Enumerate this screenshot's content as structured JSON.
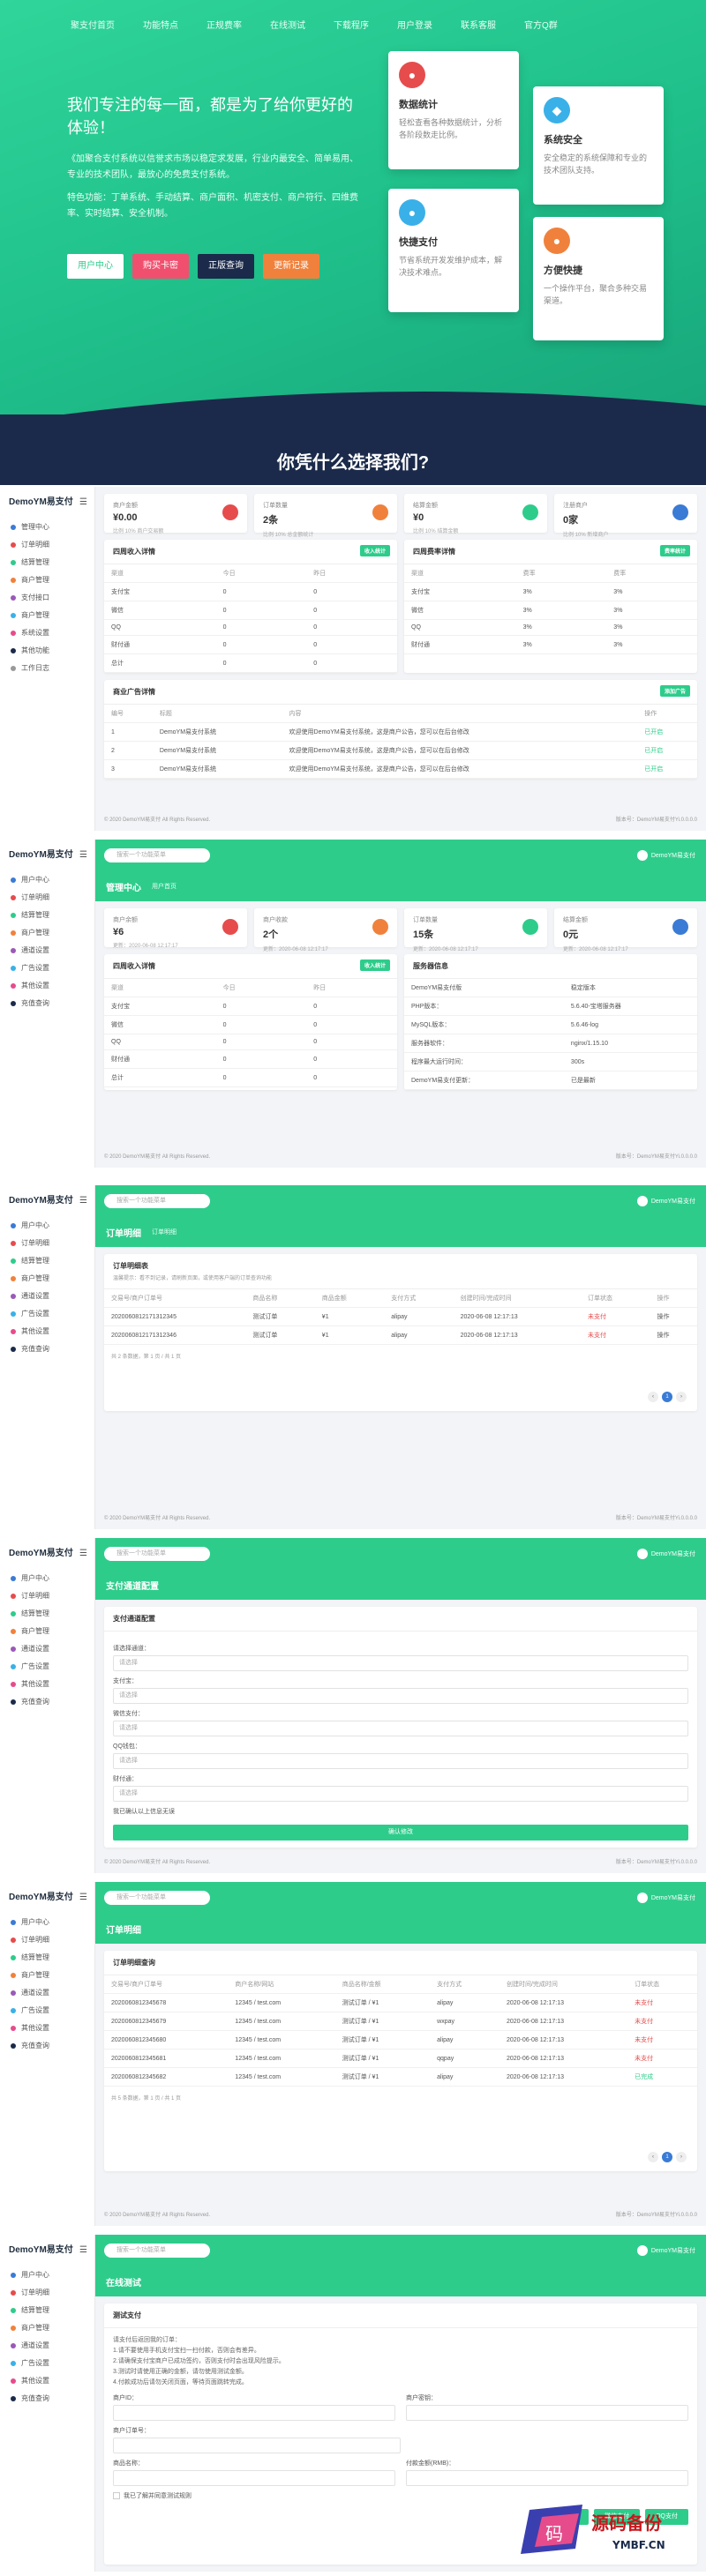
{
  "nav": [
    "聚支付首页",
    "功能特点",
    "正规费率",
    "在线测试",
    "下载程序",
    "用户登录",
    "联系客服",
    "官方Q群"
  ],
  "hero": {
    "title": "我们专注的每一面，都是为了给你更好的体验！",
    "desc1": "《加聚合支付系统以信誉求市场以稳定求发展，行业内最安全、简单易用、专业的技术团队，最放心的免费支付系统。",
    "desc2": "特色功能：丁单系统、手动结算、商户面积、机密支付、商户符行、四维费率、实时结算、安全机制。",
    "buttons": [
      "用户中心",
      "购买卡密",
      "正版查询",
      "更新记录"
    ]
  },
  "features": [
    {
      "icon": "data-stats-icon",
      "title": "数据统计",
      "desc": "轻松查看各种数据统计，分析各阶段数走比例。",
      "color": "#e64c4c"
    },
    {
      "icon": "security-icon",
      "title": "系统安全",
      "desc": "安全稳定的系统保障和专业的技术团队支持。",
      "color": "#3ab0e8"
    },
    {
      "icon": "fast-pay-icon",
      "title": "快捷支付",
      "desc": "节省系统开发发维护成本，解决技术难点。",
      "color": "#3ab0e8"
    },
    {
      "icon": "convenient-icon",
      "title": "方便快捷",
      "desc": "一个操作平台，聚合多种交易渠道。",
      "color": "#f0813c"
    }
  ],
  "why_title": "你凭什么选择我们?",
  "admin": {
    "brand": "DemoYM易支付",
    "menu": [
      "管理中心",
      "订单明细",
      "结算管理",
      "商户管理",
      "支付接口",
      "商户管理",
      "系统设置",
      "其他功能",
      "工作日志"
    ],
    "menu_b": [
      "用户中心",
      "订单明细",
      "结算管理",
      "商户管理",
      "通道设置",
      "广告设置",
      "其他设置",
      "充值查询"
    ],
    "search": "搜索一个功能菜单",
    "user": "DemoYM易支付",
    "stats1": [
      {
        "label": "商户金额",
        "value": "¥0.00",
        "sub": "比例 10% 商户交易额"
      },
      {
        "label": "订单数量",
        "value": "2条",
        "sub": "比例 10% 总金额统计"
      },
      {
        "label": "结算金额",
        "value": "¥0",
        "sub": "比例 10% 结算金额"
      },
      {
        "label": "注册商户",
        "value": "0家",
        "sub": "比例 10% 新增商户"
      }
    ],
    "income_title": "四周收入详情",
    "income_badge": "收入统计",
    "income_cols": [
      "渠道",
      "今日",
      "昨日"
    ],
    "income_rows": [
      [
        "支付宝",
        "0",
        "0"
      ],
      [
        "微信",
        "0",
        "0"
      ],
      [
        "QQ",
        "0",
        "0"
      ],
      [
        "财付通",
        "0",
        "0"
      ],
      [
        "总计",
        "0",
        "0"
      ]
    ],
    "rate_title": "四周费率详情",
    "rate_badge": "费率统计",
    "rate_cols": [
      "渠道",
      "费率",
      "费率"
    ],
    "rate_rows": [
      [
        "支付宝",
        "3%",
        "3%"
      ],
      [
        "微信",
        "3%",
        "3%"
      ],
      [
        "QQ",
        "3%",
        "3%"
      ],
      [
        "财付通",
        "3%",
        "3%"
      ]
    ],
    "ad_title": "商业广告详情",
    "ad_badge": "添加广告",
    "ad_cols": [
      "编号",
      "标题",
      "内容",
      "操作"
    ],
    "ad_rows": [
      [
        "1",
        "DemoYM易支付系统",
        "欢迎使用DemoYM易支付系统，这是商户公告，您可以在后台修改",
        "已开启"
      ],
      [
        "2",
        "DemoYM易支付系统",
        "欢迎使用DemoYM易支付系统，这是商户公告，您可以在后台修改",
        "已开启"
      ],
      [
        "3",
        "DemoYM易支付系统",
        "欢迎使用DemoYM易支付系统，这是商户公告，您可以在后台修改",
        "已开启"
      ]
    ],
    "footer": "© 2020 DemoYM易支付 All Rights Reserved.",
    "footer_r": "版本号：DemoYM易支付Yi.0.0.0.0"
  },
  "user_center": {
    "title": "管理中心",
    "crumb": "用户首页",
    "stats": [
      {
        "label": "商户余额",
        "value": "¥6",
        "sub": "更新：2020-06-08 12:17:17"
      },
      {
        "label": "商户收款",
        "value": "2个",
        "sub": "更新：2020-06-08 12:17:17"
      },
      {
        "label": "订单数量",
        "value": "15条",
        "sub": "更新：2020-06-08 12:17:17"
      },
      {
        "label": "结算金额",
        "value": "0元",
        "sub": "更新：2020-06-08 12:17:17"
      }
    ],
    "sys_title": "服务器信息",
    "sys_rows": [
      [
        "DemoYM易支付版",
        "稳定版本"
      ],
      [
        "PHP版本：",
        "5.6.40-宝塔服务器"
      ],
      [
        "MySQL版本：",
        "5.6.46-log"
      ],
      [
        "服务器软件：",
        "nginx/1.15.10"
      ],
      [
        "程序最大运行时间：",
        "300s"
      ],
      [
        "DemoYM易支付更新：",
        "已是最新"
      ]
    ]
  },
  "orders": {
    "title": "订单明细",
    "crumb": "订单明细",
    "panel": "订单明细表",
    "hint": "温馨提示：看不到记录，请刷新页面，或使用客户端的订单查询功能",
    "cols": [
      "交易号/商户订单号",
      "商品名称",
      "商品金额",
      "支付方式",
      "创建时间/完成时间",
      "订单状态",
      "操作"
    ],
    "rows": [
      [
        "2020060812171312345",
        "测试订单",
        "¥1",
        "alipay",
        "2020-06-08 12:17:13",
        "未支付",
        "操作"
      ],
      [
        "2020060812171312346",
        "测试订单",
        "¥1",
        "alipay",
        "2020-06-08 12:17:13",
        "未支付",
        "操作"
      ]
    ],
    "total": "共 2 条数据，第 1 页 / 共 1 页"
  },
  "channel": {
    "title": "支付通道配置",
    "panel": "支付通道配置",
    "fields": [
      "请选择通道：",
      "支付宝：",
      "微信支付：",
      "QQ钱包：",
      "财付通："
    ],
    "placeholder": "请选择",
    "checkbox": "我已确认以上信息无误",
    "submit": "确认修改"
  },
  "orders2": {
    "title": "订单明细",
    "panel": "订单明细查询",
    "cols": [
      "交易号/商户订单号",
      "商户名称/网站",
      "商品名称/金额",
      "支付方式",
      "创建时间/完成时间",
      "订单状态"
    ],
    "rows": [
      [
        "2020060812345678",
        "12345 / test.com",
        "测试订单 / ¥1",
        "alipay",
        "2020-06-08 12:17:13",
        "未支付"
      ],
      [
        "2020060812345679",
        "12345 / test.com",
        "测试订单 / ¥1",
        "wxpay",
        "2020-06-08 12:17:13",
        "未支付"
      ],
      [
        "2020060812345680",
        "12345 / test.com",
        "测试订单 / ¥1",
        "alipay",
        "2020-06-08 12:17:13",
        "未支付"
      ],
      [
        "2020060812345681",
        "12345 / test.com",
        "测试订单 / ¥1",
        "qqpay",
        "2020-06-08 12:17:13",
        "未支付"
      ],
      [
        "2020060812345682",
        "12345 / test.com",
        "测试订单 / ¥1",
        "alipay",
        "2020-06-08 12:17:13",
        "已完成"
      ]
    ],
    "total": "共 5 条数据，第 1 页 / 共 1 页"
  },
  "test": {
    "title": "在线测试",
    "panel": "测试支付",
    "lines": [
      "请支付后返回我的订单：",
      "1.请不要使用手机支付宝扫一扫付款，否则会有差异。",
      "2.请确保支付宝商户已成功签约，否则支付时会出现风险提示。",
      "3.测试时请使用正确的金额，请勿使用测试金额。",
      "4.付款成功后请勿关闭页面，等待页面跳转完成。"
    ],
    "f1": "商户ID：",
    "f2": "商户密钥：",
    "f3": "商户订单号：",
    "f4": "商品名称：",
    "f5": "付款金额(RMB)：",
    "check": "我已了解并同意测试规则",
    "btns": [
      "支付宝支付",
      "微信支付",
      "QQ支付"
    ]
  },
  "watermark": {
    "main": "源码备份",
    "sub": "YMBF.CN"
  }
}
